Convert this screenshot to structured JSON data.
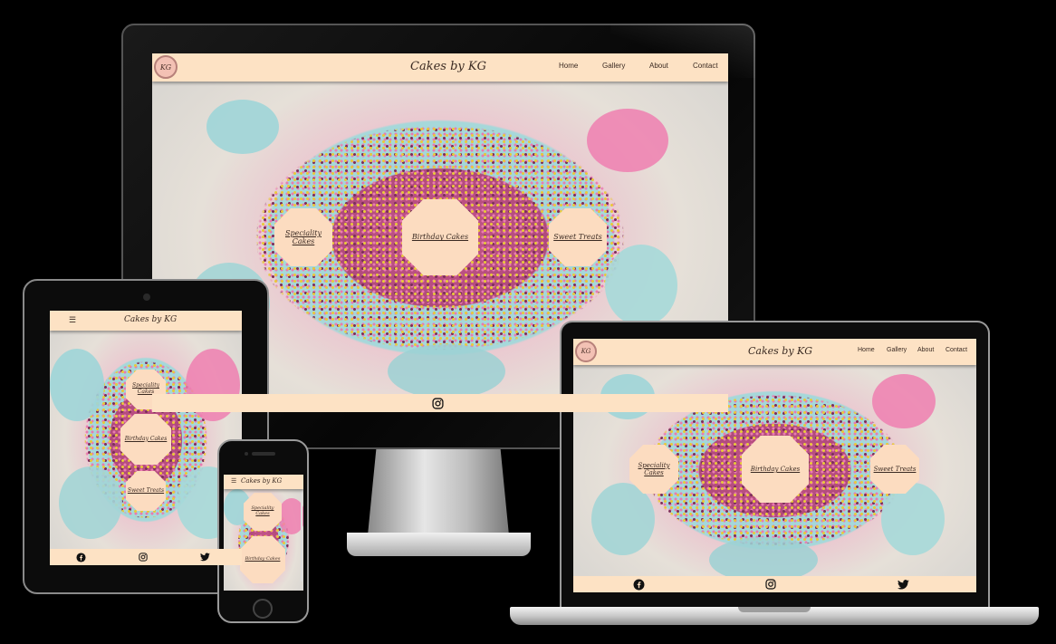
{
  "site": {
    "brand": "Cakes by KG",
    "logo_text": "KG",
    "menu_icon": "☰",
    "nav": [
      "Home",
      "Gallery",
      "About",
      "Contact"
    ],
    "categories": [
      {
        "line1": "Speciality",
        "line2": "Cakes"
      },
      {
        "line1": "Birthday Cakes",
        "line2": ""
      },
      {
        "line1": "Sweet Treats",
        "line2": ""
      }
    ],
    "footer_icons": [
      "facebook-icon",
      "instagram-icon",
      "twitter-icon"
    ]
  },
  "colors": {
    "nav_bg": "#fde2c4",
    "button_bg": "#fcdcc0",
    "text": "#3a2a22",
    "background": "#000000"
  }
}
